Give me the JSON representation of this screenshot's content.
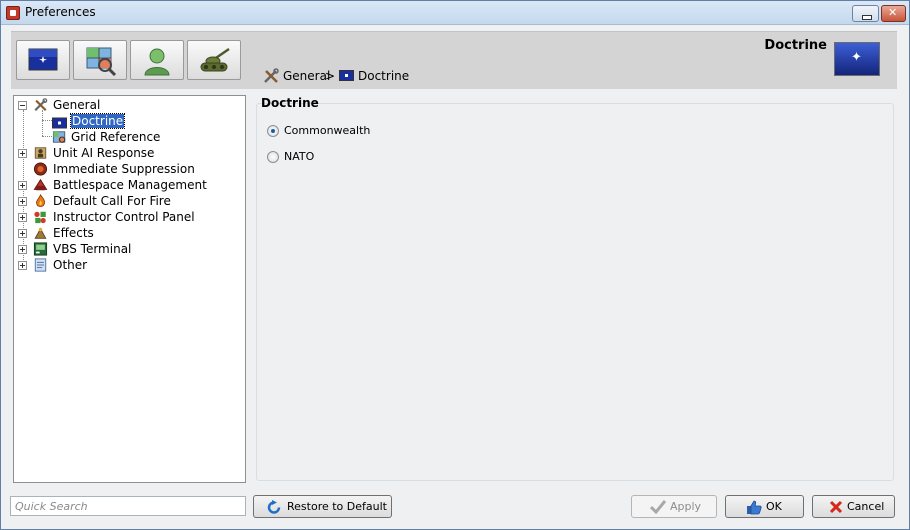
{
  "window": {
    "title": "Preferences"
  },
  "toolbar": {
    "buttons": [
      {
        "icon": "flag-icon"
      },
      {
        "icon": "map-search-icon"
      },
      {
        "icon": "user-icon"
      },
      {
        "icon": "tank-icon"
      }
    ]
  },
  "breadcrumb": {
    "items": [
      "General",
      "Doctrine"
    ],
    "separator": ">"
  },
  "header": {
    "title": "Doctrine",
    "icon": "flag-icon"
  },
  "tree": {
    "items": [
      {
        "label": "General",
        "icon": "tools-icon",
        "expanded": true
      },
      {
        "label": "Doctrine",
        "icon": "flag-icon",
        "selected": true
      },
      {
        "label": "Grid Reference",
        "icon": "map-icon"
      },
      {
        "label": "Unit AI Response",
        "icon": "soldier-icon"
      },
      {
        "label": "Immediate Suppression",
        "icon": "explosion-icon"
      },
      {
        "label": "Battlespace Management",
        "icon": "battlespace-icon"
      },
      {
        "label": "Default Call For Fire",
        "icon": "fire-icon"
      },
      {
        "label": "Instructor Control Panel",
        "icon": "control-panel-icon"
      },
      {
        "label": "Effects",
        "icon": "effects-icon"
      },
      {
        "label": "VBS Terminal",
        "icon": "terminal-icon"
      },
      {
        "label": "Other",
        "icon": "document-icon"
      }
    ]
  },
  "content": {
    "group_title": "Doctrine",
    "options": [
      {
        "label": "Commonwealth",
        "checked": true
      },
      {
        "label": "NATO",
        "checked": false
      }
    ]
  },
  "footer": {
    "search_placeholder": "Quick Search",
    "restore_label": "Restore to Default",
    "apply_label": "Apply",
    "ok_label": "OK",
    "cancel_label": "Cancel"
  },
  "colors": {
    "selection": "#3067c2",
    "flag_blue": "#13247a",
    "header_band": "#d4d4d4"
  }
}
